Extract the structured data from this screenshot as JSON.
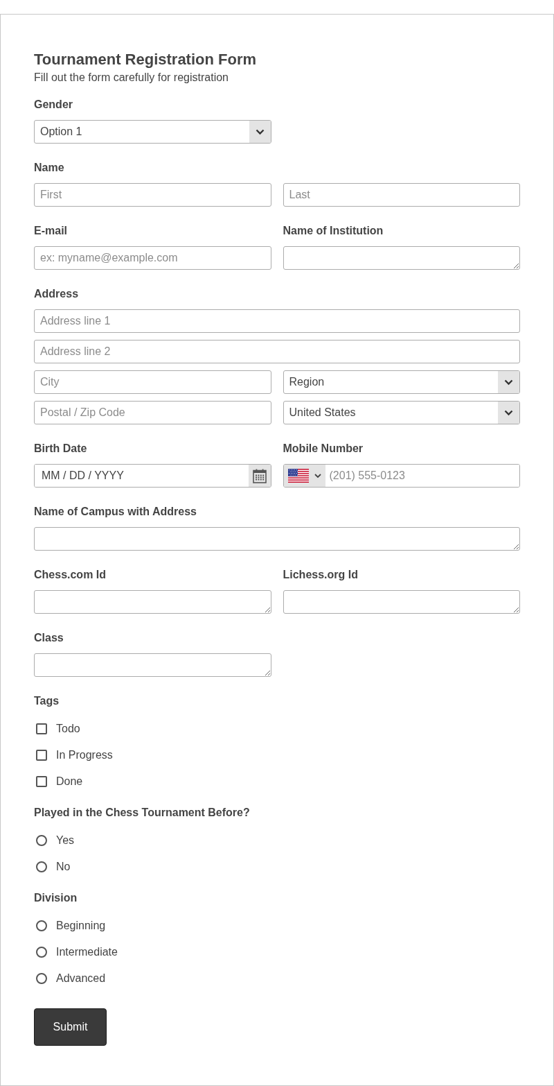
{
  "title": "Tournament Registration Form",
  "subtitle": "Fill out the form carefully for registration",
  "gender": {
    "label": "Gender",
    "value": "Option 1"
  },
  "name": {
    "label": "Name",
    "first": {
      "placeholder": "First"
    },
    "last": {
      "placeholder": "Last"
    }
  },
  "email": {
    "label": "E-mail",
    "placeholder": "ex: myname@example.com"
  },
  "institution": {
    "label": "Name of Institution"
  },
  "address": {
    "label": "Address",
    "line1": {
      "placeholder": "Address line 1"
    },
    "line2": {
      "placeholder": "Address line 2"
    },
    "city": {
      "placeholder": "City"
    },
    "region": {
      "value": "Region"
    },
    "postal": {
      "placeholder": "Postal / Zip Code"
    },
    "country": {
      "value": "United States"
    }
  },
  "birth_date": {
    "label": "Birth Date",
    "placeholder": "MM / DD / YYYY"
  },
  "mobile": {
    "label": "Mobile Number",
    "placeholder": "(201) 555-0123"
  },
  "campus": {
    "label": "Name of Campus with Address"
  },
  "chess_com": {
    "label": "Chess.com Id"
  },
  "lichess": {
    "label": "Lichess.org Id"
  },
  "class": {
    "label": "Class"
  },
  "tags": {
    "label": "Tags",
    "options": [
      {
        "label": "Todo",
        "checked": false
      },
      {
        "label": "In Progress",
        "checked": false
      },
      {
        "label": "Done",
        "checked": false
      }
    ]
  },
  "played_before": {
    "label": "Played in the Chess Tournament Before?",
    "options": [
      {
        "label": "Yes",
        "selected": false
      },
      {
        "label": "No",
        "selected": false
      }
    ]
  },
  "division": {
    "label": "Division",
    "options": [
      {
        "label": "Beginning",
        "selected": false
      },
      {
        "label": "Intermediate",
        "selected": false
      },
      {
        "label": "Advanced",
        "selected": false
      }
    ]
  },
  "submit": "Submit"
}
